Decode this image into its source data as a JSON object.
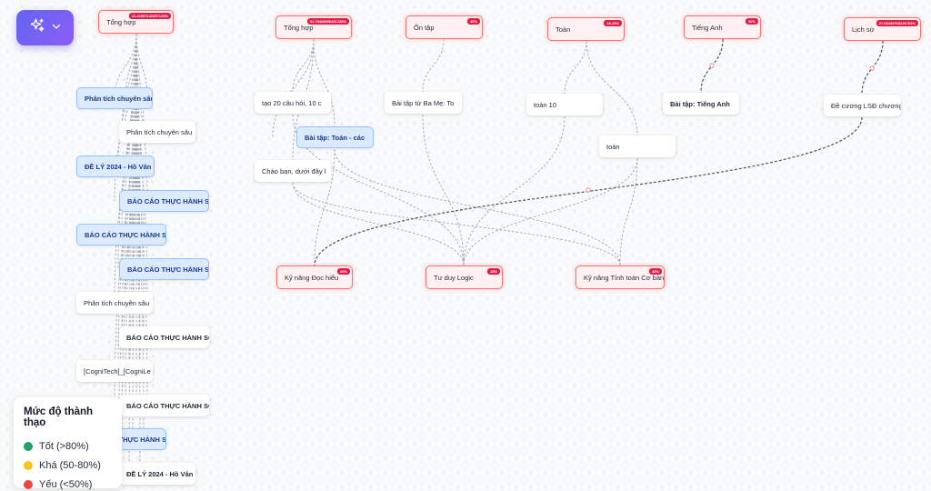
{
  "colors": {
    "good": "#22a06b",
    "fair": "#f5c518",
    "weak": "#ef4444",
    "accent": "#7c5cf0",
    "node_border": "#f87171"
  },
  "toolbar": {
    "ai_icon": "sparkles-icon",
    "dropdown_icon": "chevron-down-icon"
  },
  "legend": {
    "title": "Mức độ thành thạo",
    "items": [
      {
        "label": "Tốt (>80%)",
        "color": "#22a06b"
      },
      {
        "label": "Khá (50-80%)",
        "color": "#f5c518"
      },
      {
        "label": "Yếu (<50%)",
        "color": "#ef4444"
      }
    ]
  },
  "topics": [
    {
      "label": "Tổng hợp",
      "badge": "41.42857142857143%"
    },
    {
      "label": "Tổng hợp",
      "badge": "31.75438596491228%"
    },
    {
      "label": "Ôn tập",
      "badge": "40%"
    },
    {
      "label": "Toán",
      "badge": "16.25%"
    },
    {
      "label": "Tiếng Anh",
      "badge": "30%"
    },
    {
      "label": "Lịch sử",
      "badge": "27.69230769230769%"
    }
  ],
  "skills": [
    {
      "label": "Kỹ năng Đọc hiểu",
      "badge": "20%"
    },
    {
      "label": "Tư duy Logic",
      "badge": "15%"
    },
    {
      "label": "Kỹ năng Tính toán Cơ bản",
      "badge": "40%"
    }
  ],
  "docs": [
    {
      "label": "Phân tích chuyên sâu",
      "style": "blue"
    },
    {
      "label": "Phân tích chuyên sâu",
      "style": "doc"
    },
    {
      "label": "ĐỀ LÝ 2024 - Hồ Văn",
      "style": "blue"
    },
    {
      "label": "BÁO CÁO THỰC HÀNH SỐ",
      "style": "blue"
    },
    {
      "label": "BÁO CÁO THỰC HÀNH SỐ",
      "style": "blue"
    },
    {
      "label": "BÁO CÁO THỰC HÀNH SỐ",
      "style": "blue"
    },
    {
      "label": "Phân tích chuyên sâu",
      "style": "doc"
    },
    {
      "label": "BÁO CÁO THỰC HÀNH SỐ",
      "style": "doc bold"
    },
    {
      "label": "[CogniTech]_[CogniLe",
      "style": "doc"
    },
    {
      "label": "BÁO CÁO THỰC HÀNH SỐ",
      "style": "doc bold"
    },
    {
      "label": "BÁO CÁO THỰC HÀNH SỐ",
      "style": "blue"
    },
    {
      "label": "ĐỀ LÝ 2024 - Hồ Văn",
      "style": "doc bold"
    },
    {
      "label": "tạo 20 câu hỏi, 10 c",
      "style": "doc"
    },
    {
      "label": "Bài tập: Toán - các",
      "style": "blue"
    },
    {
      "label": "Chào bạn, dưới đây l",
      "style": "doc"
    },
    {
      "label": "Bài tập từ Ba Mẹ: To",
      "style": "doc"
    },
    {
      "label": "toán 10",
      "style": "doc"
    },
    {
      "label": "toán",
      "style": "doc"
    },
    {
      "label": "Bài tập: Tiếng Anh",
      "style": "doc bold"
    },
    {
      "label": "Đề cương LSĐ chương",
      "style": "doc"
    }
  ]
}
